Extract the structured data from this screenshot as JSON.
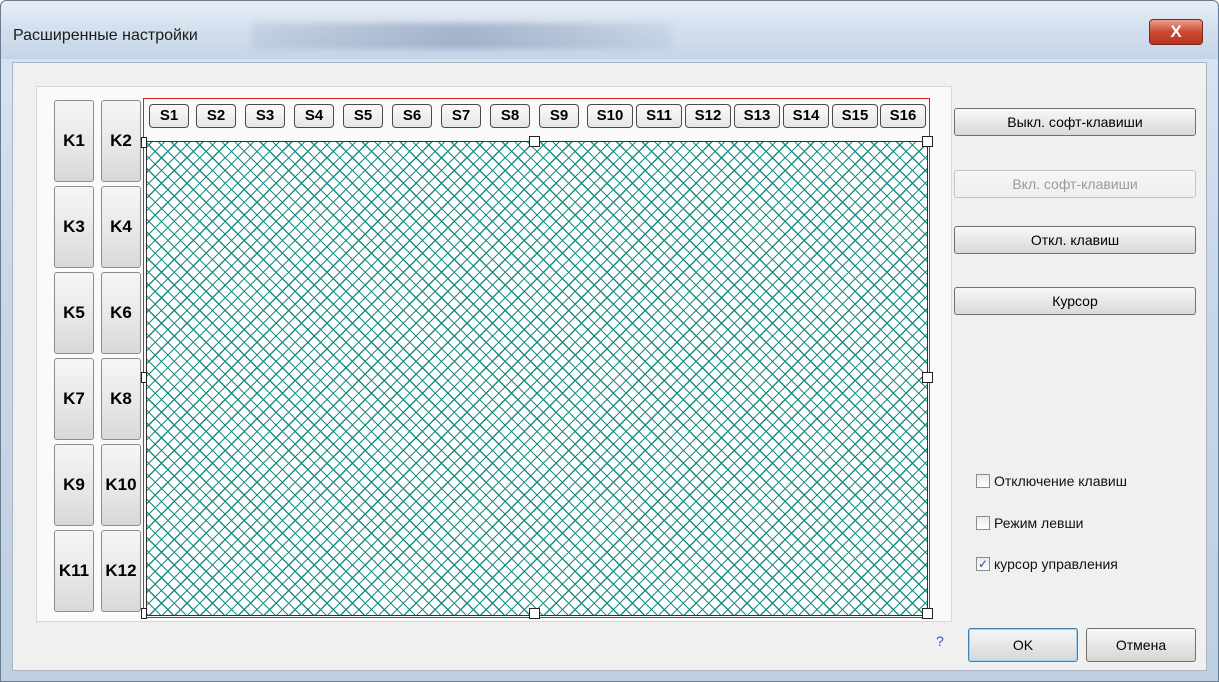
{
  "window": {
    "title": "Расширенные настройки",
    "close_label": "X"
  },
  "k_keys": [
    "K1",
    "K2",
    "K3",
    "K4",
    "K5",
    "K6",
    "K7",
    "K8",
    "K9",
    "K10",
    "K11",
    "K12"
  ],
  "s_keys": [
    "S1",
    "S2",
    "S3",
    "S4",
    "S5",
    "S6",
    "S7",
    "S8",
    "S9",
    "S10",
    "S11",
    "S12",
    "S13",
    "S14",
    "S15",
    "S16"
  ],
  "right_buttons": {
    "disable_soft": "Выкл. софт-клавиши",
    "enable_soft": "Вкл. софт-клавиши",
    "disable_keys": "Откл. клавиш",
    "cursor": "Курсор"
  },
  "checkboxes": {
    "keys_off": {
      "label": "Отключение клавиш",
      "checked": false
    },
    "left_mode": {
      "label": "Режим левши",
      "checked": false
    },
    "control_cursor": {
      "label": "курсор управления",
      "checked": true
    }
  },
  "footer": {
    "help": "?",
    "ok": "OK",
    "cancel": "Отмена"
  },
  "colors": {
    "grid": "#1b8f86",
    "frame": "#d32020",
    "close": "#cc4a32"
  }
}
